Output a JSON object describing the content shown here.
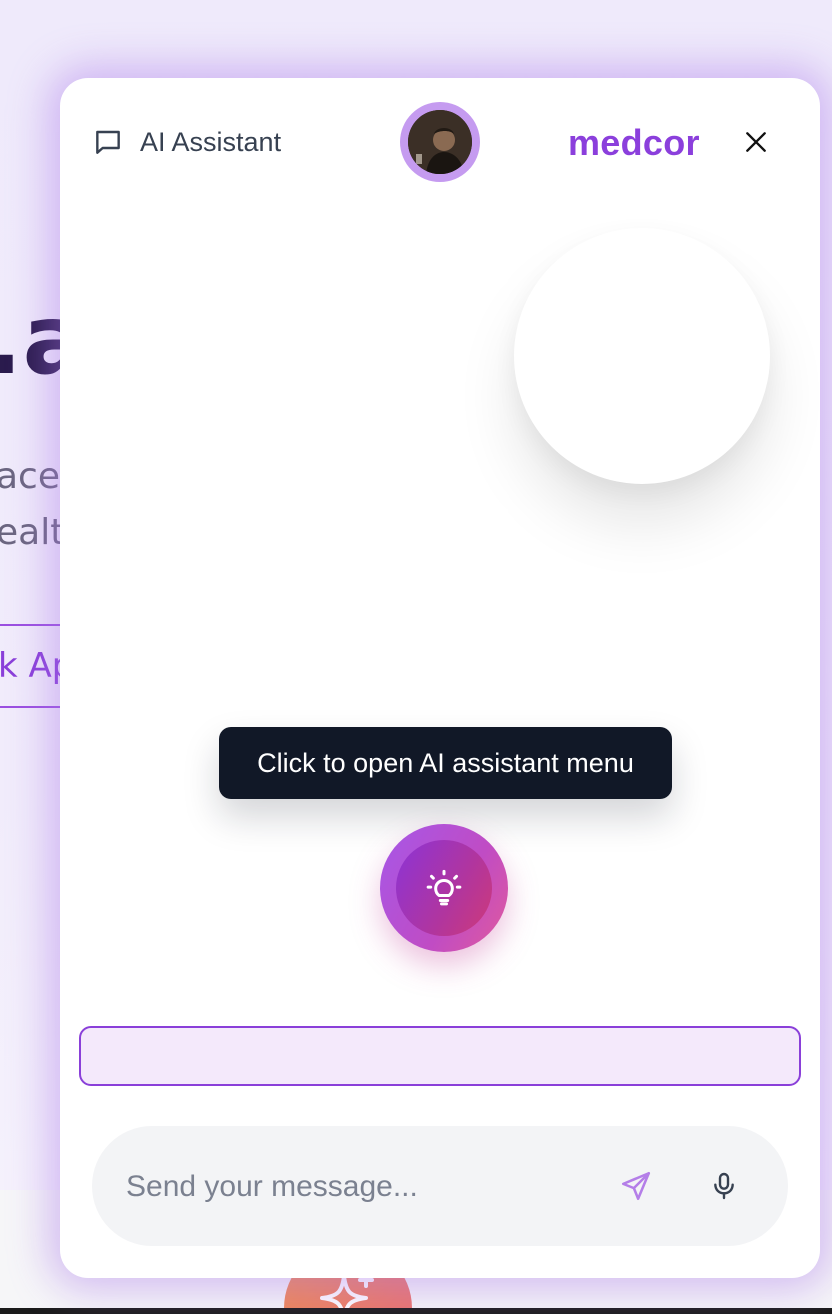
{
  "background_page": {
    "heading_fragment": ".a",
    "line_1_fragment": "ace",
    "line_2_fragment": "ealt",
    "cta_fragment": "k Ap"
  },
  "panel": {
    "header": {
      "title": "AI Assistant",
      "title_icon": "chat-bubble-icon",
      "brand": "medcor",
      "close_icon": "close-icon"
    },
    "tooltip": {
      "text": "Click to open AI assistant menu"
    },
    "ai_button": {
      "icon": "lightbulb-icon"
    },
    "composer": {
      "placeholder": "Send your message...",
      "value": "",
      "send_icon": "send-icon",
      "mic_icon": "microphone-icon"
    }
  },
  "colors": {
    "brand": "#8b3fdc",
    "tooltip_bg": "#111827",
    "suggestion_border": "#8a3fd9",
    "suggestion_bg": "#f4e9fb",
    "composer_bg": "#f3f4f6"
  }
}
